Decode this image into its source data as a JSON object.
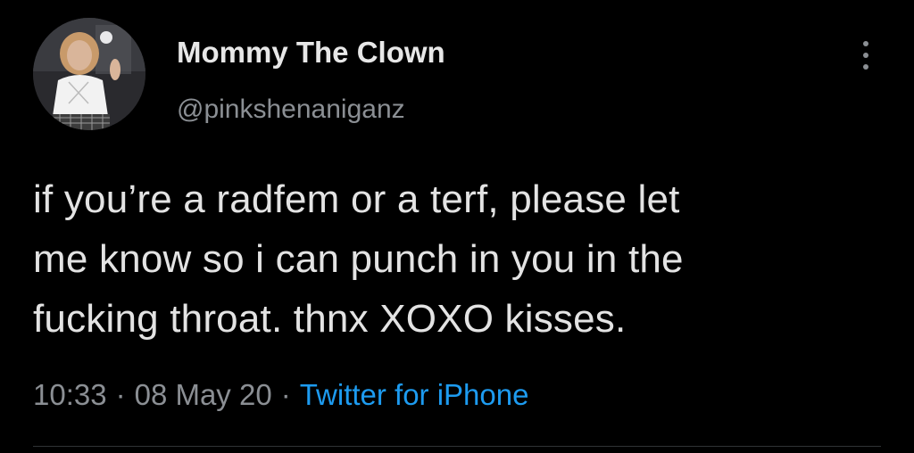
{
  "user": {
    "display_name": "Mommy The Clown",
    "handle": "@pinkshenaniganz",
    "avatar_icon": "profile-photo"
  },
  "tweet": {
    "lines": [
      "if you’re a radfem or a terf, please let",
      "me know so i can punch in you in the",
      "fucking throat. thnx XOXO kisses."
    ]
  },
  "meta": {
    "time": "10:33",
    "separator": "·",
    "date": "08 May 20",
    "source": "Twitter for iPhone"
  },
  "icons": {
    "more": "more-vertical-icon"
  },
  "colors": {
    "background": "#000000",
    "text": "#e3e3e3",
    "secondary": "#8b8f94",
    "link": "#1d9bf0"
  }
}
